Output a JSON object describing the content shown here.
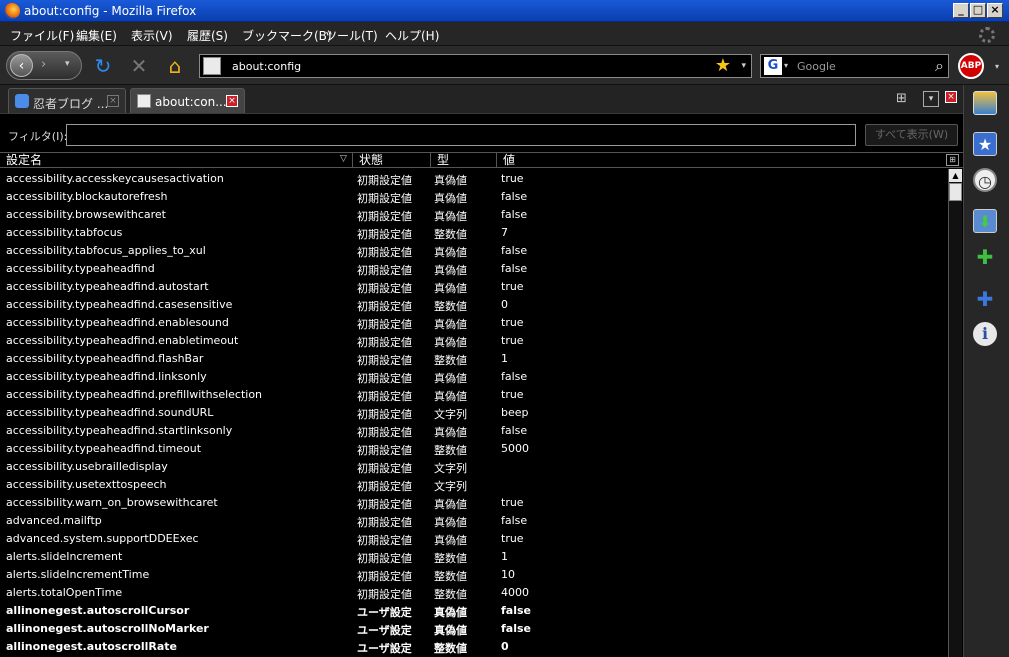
{
  "window": {
    "title": "about:config - Mozilla Firefox"
  },
  "menu": {
    "items": [
      "ファイル(F)",
      "編集(E)",
      "表示(V)",
      "履歴(S)",
      "ブックマーク(B)",
      "ツール(T)",
      "ヘルプ(H)"
    ]
  },
  "nav": {
    "url": "about:config",
    "search_placeholder": "Google",
    "abp_label": "ABP"
  },
  "tabs": [
    {
      "label": "忍者ブログ ..."
    },
    {
      "label": "about:con..."
    }
  ],
  "filter": {
    "label": "フィルタ(I):",
    "value": "",
    "show_all_label": "すべて表示(W)"
  },
  "table": {
    "headers": [
      "設定名",
      "状態",
      "型",
      "値"
    ],
    "rows": [
      {
        "name": "accessibility.accesskeycausesactivation",
        "status": "初期設定値",
        "type": "真偽値",
        "value": "true",
        "bold": false
      },
      {
        "name": "accessibility.blockautorefresh",
        "status": "初期設定値",
        "type": "真偽値",
        "value": "false",
        "bold": false
      },
      {
        "name": "accessibility.browsewithcaret",
        "status": "初期設定値",
        "type": "真偽値",
        "value": "false",
        "bold": false
      },
      {
        "name": "accessibility.tabfocus",
        "status": "初期設定値",
        "type": "整数値",
        "value": "7",
        "bold": false
      },
      {
        "name": "accessibility.tabfocus_applies_to_xul",
        "status": "初期設定値",
        "type": "真偽値",
        "value": "false",
        "bold": false
      },
      {
        "name": "accessibility.typeaheadfind",
        "status": "初期設定値",
        "type": "真偽値",
        "value": "false",
        "bold": false
      },
      {
        "name": "accessibility.typeaheadfind.autostart",
        "status": "初期設定値",
        "type": "真偽値",
        "value": "true",
        "bold": false
      },
      {
        "name": "accessibility.typeaheadfind.casesensitive",
        "status": "初期設定値",
        "type": "整数値",
        "value": "0",
        "bold": false
      },
      {
        "name": "accessibility.typeaheadfind.enablesound",
        "status": "初期設定値",
        "type": "真偽値",
        "value": "true",
        "bold": false
      },
      {
        "name": "accessibility.typeaheadfind.enabletimeout",
        "status": "初期設定値",
        "type": "真偽値",
        "value": "true",
        "bold": false
      },
      {
        "name": "accessibility.typeaheadfind.flashBar",
        "status": "初期設定値",
        "type": "整数値",
        "value": "1",
        "bold": false
      },
      {
        "name": "accessibility.typeaheadfind.linksonly",
        "status": "初期設定値",
        "type": "真偽値",
        "value": "false",
        "bold": false
      },
      {
        "name": "accessibility.typeaheadfind.prefillwithselection",
        "status": "初期設定値",
        "type": "真偽値",
        "value": "true",
        "bold": false
      },
      {
        "name": "accessibility.typeaheadfind.soundURL",
        "status": "初期設定値",
        "type": "文字列",
        "value": "beep",
        "bold": false
      },
      {
        "name": "accessibility.typeaheadfind.startlinksonly",
        "status": "初期設定値",
        "type": "真偽値",
        "value": "false",
        "bold": false
      },
      {
        "name": "accessibility.typeaheadfind.timeout",
        "status": "初期設定値",
        "type": "整数値",
        "value": "5000",
        "bold": false
      },
      {
        "name": "accessibility.usebrailledisplay",
        "status": "初期設定値",
        "type": "文字列",
        "value": "",
        "bold": false
      },
      {
        "name": "accessibility.usetexttospeech",
        "status": "初期設定値",
        "type": "文字列",
        "value": "",
        "bold": false
      },
      {
        "name": "accessibility.warn_on_browsewithcaret",
        "status": "初期設定値",
        "type": "真偽値",
        "value": "true",
        "bold": false
      },
      {
        "name": "advanced.mailftp",
        "status": "初期設定値",
        "type": "真偽値",
        "value": "false",
        "bold": false
      },
      {
        "name": "advanced.system.supportDDEExec",
        "status": "初期設定値",
        "type": "真偽値",
        "value": "true",
        "bold": false
      },
      {
        "name": "alerts.slideIncrement",
        "status": "初期設定値",
        "type": "整数値",
        "value": "1",
        "bold": false
      },
      {
        "name": "alerts.slideIncrementTime",
        "status": "初期設定値",
        "type": "整数値",
        "value": "10",
        "bold": false
      },
      {
        "name": "alerts.totalOpenTime",
        "status": "初期設定値",
        "type": "整数値",
        "value": "4000",
        "bold": false
      },
      {
        "name": "allinonegest.autoscrollCursor",
        "status": "ユーザ設定",
        "type": "真偽値",
        "value": "false",
        "bold": true
      },
      {
        "name": "allinonegest.autoscrollNoMarker",
        "status": "ユーザ設定",
        "type": "真偽値",
        "value": "false",
        "bold": true
      },
      {
        "name": "allinonegest.autoscrollRate",
        "status": "ユーザ設定",
        "type": "整数値",
        "value": "0",
        "bold": true
      }
    ]
  },
  "sidebar": {
    "icons": [
      "gallery-icon",
      "bookmark-star-icon",
      "history-clock-icon",
      "download-icon",
      "addons-puzzle-icon",
      "puzzle-icon",
      "info-icon"
    ]
  },
  "colors": {
    "background": "#000000",
    "titlebar": "#0a3fb0",
    "toolbar": "#2a2a2a",
    "accent_close": "#c9202a",
    "abp": "#d20000"
  }
}
